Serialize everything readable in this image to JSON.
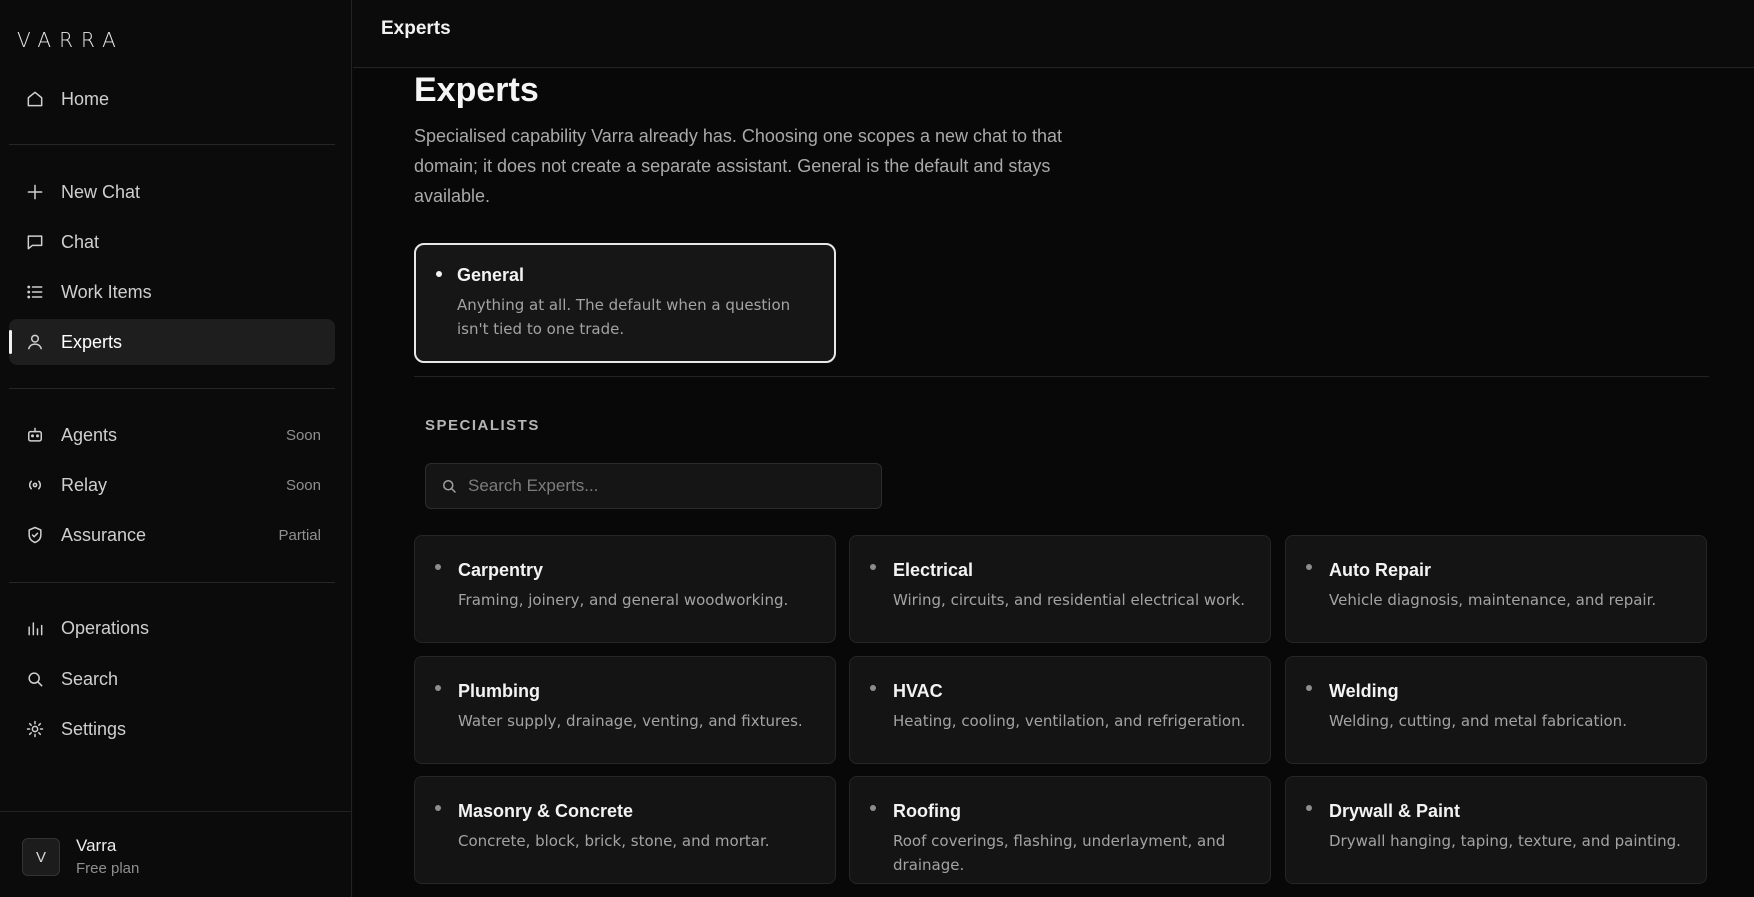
{
  "app": {
    "logo": "VARRA"
  },
  "sidebar": {
    "items": [
      {
        "label": "Home",
        "icon": "home-icon"
      },
      {
        "label": "New Chat",
        "icon": "plus-icon"
      },
      {
        "label": "Chat",
        "icon": "chat-icon"
      },
      {
        "label": "Work Items",
        "icon": "list-icon"
      },
      {
        "label": "Experts",
        "icon": "user-icon",
        "active": true
      },
      {
        "label": "Agents",
        "icon": "robot-icon",
        "badge": "Soon"
      },
      {
        "label": "Relay",
        "icon": "broadcast-icon",
        "badge": "Soon"
      },
      {
        "label": "Assurance",
        "icon": "shield-icon",
        "badge": "Partial"
      },
      {
        "label": "Operations",
        "icon": "bar-chart-icon"
      },
      {
        "label": "Search",
        "icon": "search-icon"
      },
      {
        "label": "Settings",
        "icon": "gear-icon"
      }
    ],
    "account": {
      "initial": "V",
      "name": "Varra",
      "plan": "Free plan"
    }
  },
  "topbar": {
    "title": "Experts"
  },
  "main": {
    "title": "Experts",
    "description": "Specialised capability Varra already has. Choosing one scopes a new chat to that domain; it does not create a separate assistant. General is the default and stays available.",
    "general": {
      "title": "General",
      "description": "Anything at all. The default when a question isn't tied to one trade."
    },
    "specialists_label": "SPECIALISTS",
    "search": {
      "placeholder": "Search Experts..."
    },
    "specialists": [
      {
        "title": "Carpentry",
        "description": "Framing, joinery, and general woodworking."
      },
      {
        "title": "Electrical",
        "description": "Wiring, circuits, and residential electrical work."
      },
      {
        "title": "Auto Repair",
        "description": "Vehicle diagnosis, maintenance, and repair."
      },
      {
        "title": "Plumbing",
        "description": "Water supply, drainage, venting, and fixtures."
      },
      {
        "title": "HVAC",
        "description": "Heating, cooling, ventilation, and refrigeration."
      },
      {
        "title": "Welding",
        "description": "Welding, cutting, and metal fabrication."
      },
      {
        "title": "Masonry & Concrete",
        "description": "Concrete, block, brick, stone, and mortar."
      },
      {
        "title": "Roofing",
        "description": "Roof coverings, flashing, underlayment, and drainage."
      },
      {
        "title": "Drywall & Paint",
        "description": "Drywall hanging, taping, texture, and painting."
      }
    ]
  }
}
